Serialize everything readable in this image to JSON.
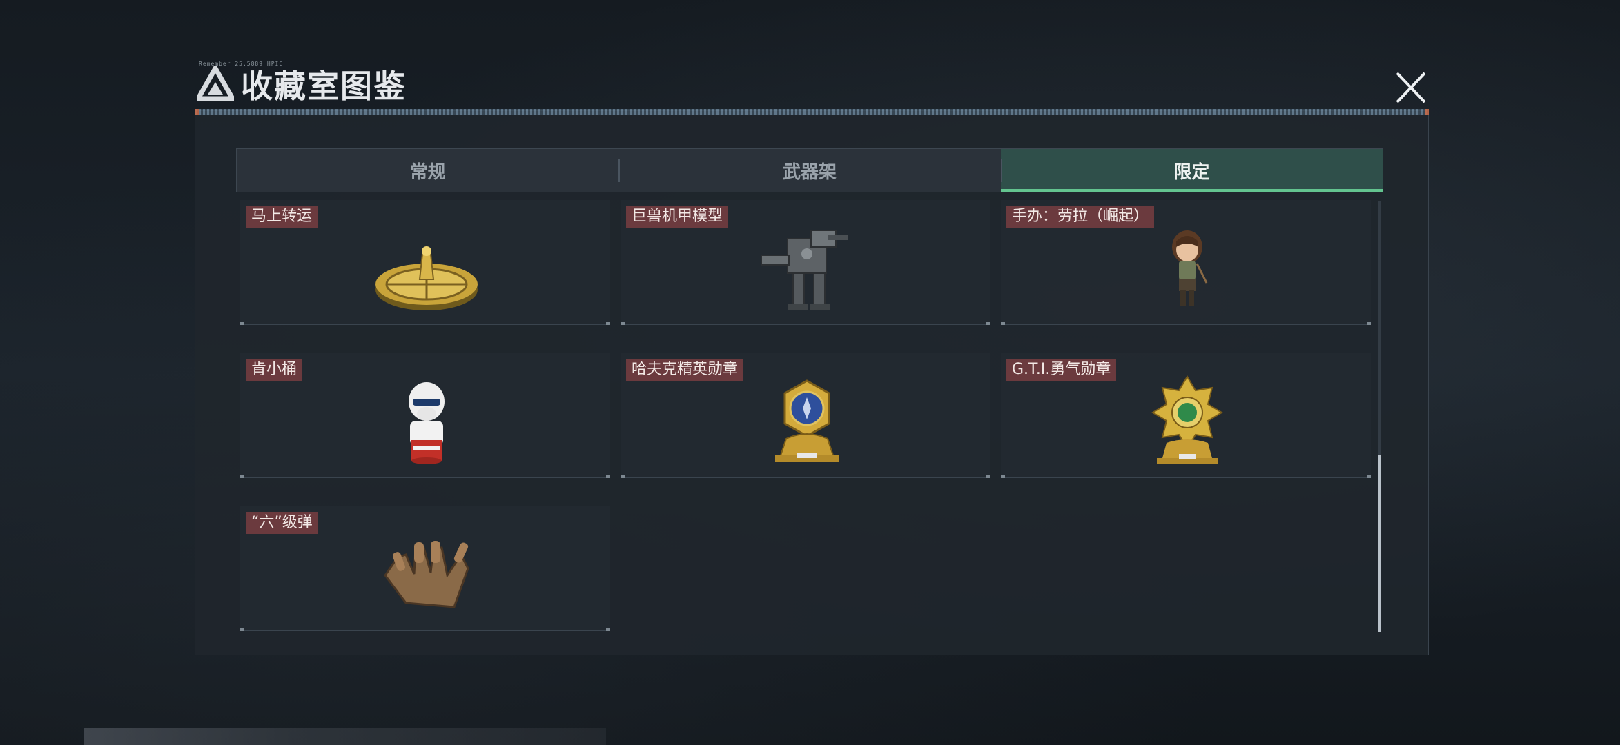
{
  "header": {
    "title": "收藏室图鉴",
    "subtitle_mini": "Remember 25.5889 HPIC"
  },
  "tabs": [
    {
      "label": "常规",
      "active": false
    },
    {
      "label": "武器架",
      "active": false
    },
    {
      "label": "限定",
      "active": true
    }
  ],
  "items": [
    {
      "label": "马上转运",
      "icon": "golden-turntable-icon"
    },
    {
      "label": "巨兽机甲模型",
      "icon": "mech-model-icon"
    },
    {
      "label": "手办：劳拉（崛起）",
      "icon": "lara-figure-icon"
    },
    {
      "label": "肯小桶",
      "icon": "kfc-colonel-figure-icon"
    },
    {
      "label": "哈夫克精英勋章",
      "icon": "haavk-elite-medal-icon"
    },
    {
      "label": "G.T.I.勇气勋章",
      "icon": "gti-courage-medal-icon"
    },
    {
      "label": "“六”级弹",
      "icon": "six-bullets-hand-icon"
    }
  ],
  "colors": {
    "accent_green": "#63c48f",
    "label_bg": "#6b3a3e",
    "panel_bg": "#1f262d"
  },
  "scroll": {
    "position_fraction": 0.59
  }
}
